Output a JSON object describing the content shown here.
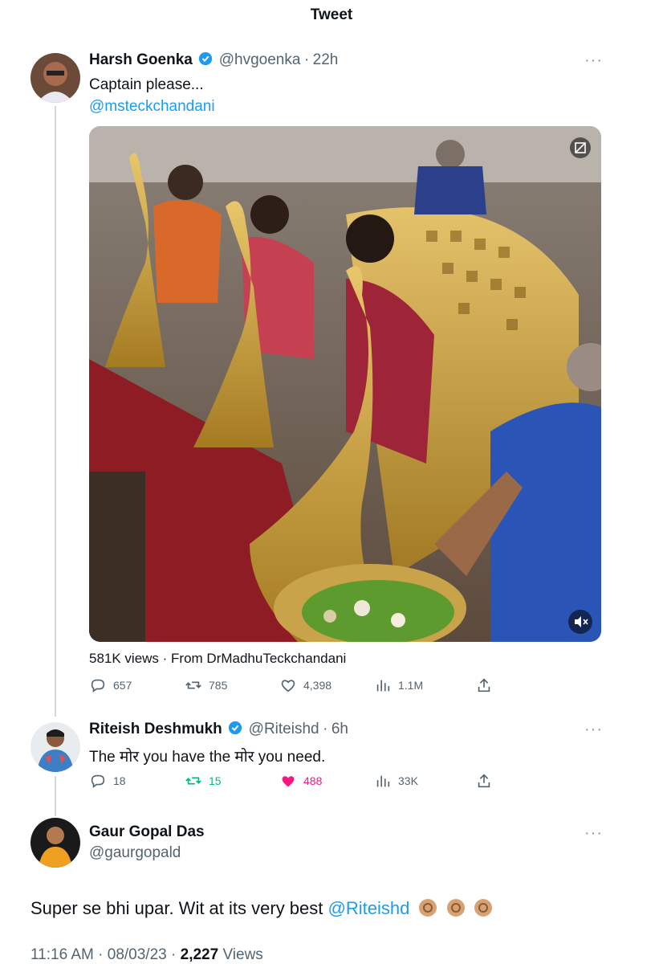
{
  "header": {
    "title": "Tweet"
  },
  "tweet1": {
    "author": "Harsh Goenka",
    "handle": "@hvgoenka",
    "sep": "·",
    "time": "22h",
    "text": "Captain please...",
    "mention": "@msteckchandani",
    "views_line": "581K views · From DrMadhuTeckchandani",
    "replies": "657",
    "retweets": "785",
    "likes": "4,398",
    "views": "1.1M",
    "more": "···"
  },
  "tweet2": {
    "author": "Riteish Deshmukh",
    "handle": "@Riteishd",
    "sep": "·",
    "time": "6h",
    "text": "The मोर you have the मोर you need.",
    "replies": "18",
    "retweets": "15",
    "likes": "488",
    "views": "33K",
    "more": "···",
    "retweet_color": "#00ba7c",
    "like_color": "#f91880"
  },
  "tweet3": {
    "author": "Gaur Gopal Das",
    "handle": "@gaurgopald",
    "text": "Super se bhi upar. Wit at its very best",
    "mention": "@Riteishd",
    "more": "···",
    "time": "11:16 AM",
    "date": "08/03/23",
    "views_count": "2,227",
    "views_label": "Views",
    "sep": "·"
  },
  "icons": [
    "verified-icon",
    "reply-icon",
    "retweet-icon",
    "like-icon",
    "views-icon",
    "share-icon",
    "more-icon",
    "mute-icon",
    "media-badge-icon"
  ],
  "colors": {
    "accent": "#1d9bf0",
    "text": "#0f1419",
    "muted": "#536471",
    "retweet": "#00ba7c",
    "like": "#f91880"
  }
}
